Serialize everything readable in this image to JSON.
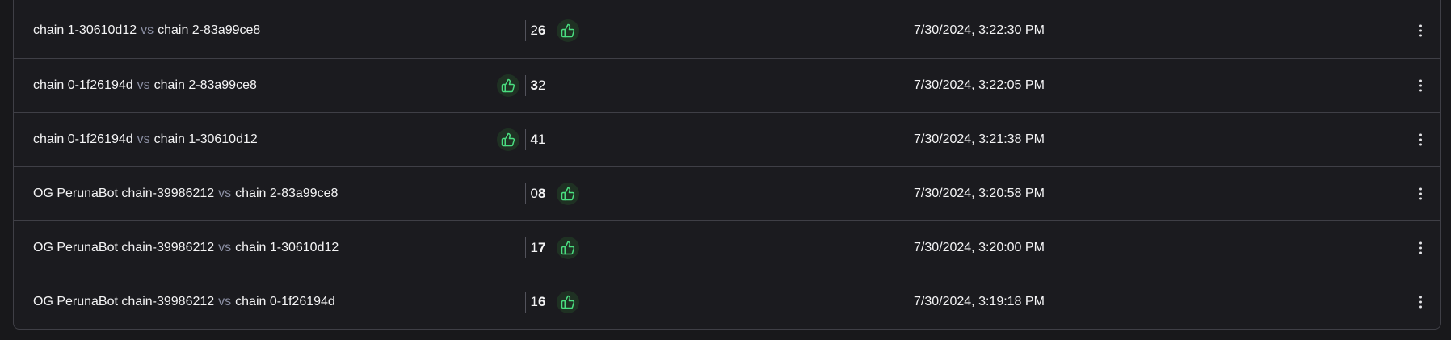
{
  "vs_label": "vs",
  "colors": {
    "win_icon": "#4ade80",
    "win_icon_bg": "#1f3123"
  },
  "rows": [
    {
      "left": "chain 1-30610d12",
      "right": "chain 2-83a99ce8",
      "left_score": "2",
      "right_score": "6",
      "winner": "right",
      "date": "7/30/2024, 3:22:30 PM"
    },
    {
      "left": "chain 0-1f26194d",
      "right": "chain 2-83a99ce8",
      "left_score": "3",
      "right_score": "2",
      "winner": "left",
      "date": "7/30/2024, 3:22:05 PM"
    },
    {
      "left": "chain 0-1f26194d",
      "right": "chain 1-30610d12",
      "left_score": "4",
      "right_score": "1",
      "winner": "left",
      "date": "7/30/2024, 3:21:38 PM"
    },
    {
      "left": "OG PerunaBot chain-39986212",
      "right": "chain 2-83a99ce8",
      "left_score": "0",
      "right_score": "8",
      "winner": "right",
      "date": "7/30/2024, 3:20:58 PM"
    },
    {
      "left": "OG PerunaBot chain-39986212",
      "right": "chain 1-30610d12",
      "left_score": "1",
      "right_score": "7",
      "winner": "right",
      "date": "7/30/2024, 3:20:00 PM"
    },
    {
      "left": "OG PerunaBot chain-39986212",
      "right": "chain 0-1f26194d",
      "left_score": "1",
      "right_score": "6",
      "winner": "right",
      "date": "7/30/2024, 3:19:18 PM"
    }
  ]
}
